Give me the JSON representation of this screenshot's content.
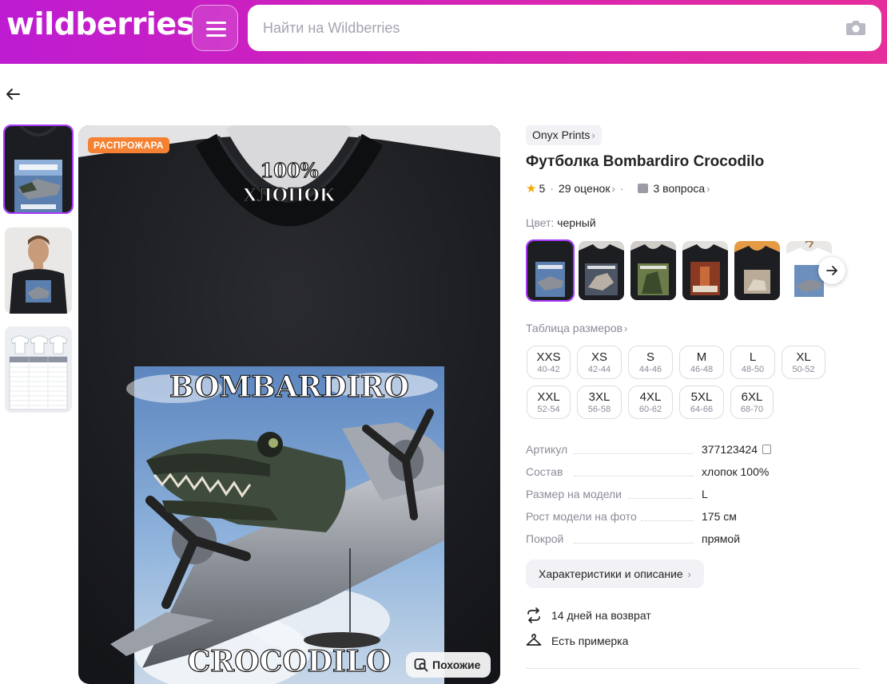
{
  "header": {
    "logo": "wildberries",
    "search_placeholder": "Найти на Wildberries"
  },
  "gallery": {
    "badge": "РАСПРОЖАРА",
    "similar_label": "Похожие",
    "print_top": "100%",
    "print_bottom": "ХЛОПОК",
    "graphic_title": "BOMBARDIRO",
    "graphic_caption": "CROCODILO"
  },
  "product": {
    "brand": "Onyx Prints",
    "title": "Футболка Bombardiro Crocodilo",
    "rating": "5",
    "reviews": "29 оценок",
    "questions": "3 вопроса",
    "color_label": "Цвет:",
    "color_value": "черный",
    "sizes_table_link": "Таблица размеров",
    "sizes": [
      {
        "size": "XXS",
        "range": "40-42"
      },
      {
        "size": "XS",
        "range": "42-44"
      },
      {
        "size": "S",
        "range": "44-46"
      },
      {
        "size": "M",
        "range": "46-48"
      },
      {
        "size": "L",
        "range": "48-50"
      },
      {
        "size": "XL",
        "range": "50-52"
      },
      {
        "size": "XXL",
        "range": "52-54"
      },
      {
        "size": "3XL",
        "range": "56-58"
      },
      {
        "size": "4XL",
        "range": "60-62"
      },
      {
        "size": "5XL",
        "range": "64-66"
      },
      {
        "size": "6XL",
        "range": "68-70"
      }
    ],
    "specs": [
      {
        "key": "Артикул",
        "value": "377123424"
      },
      {
        "key": "Состав",
        "value": "хлопок 100%"
      },
      {
        "key": "Размер на модели",
        "value": "L"
      },
      {
        "key": "Рост модели на фото",
        "value": "175 см"
      },
      {
        "key": "Покрой",
        "value": "прямой"
      }
    ],
    "details_button": "Характеристики и описание",
    "features": [
      {
        "icon": "return-arrows-icon",
        "label": "14 дней на возврат"
      },
      {
        "icon": "hanger-icon",
        "label": "Есть примерка"
      }
    ]
  },
  "colors": {
    "accent": "#a73afd",
    "brand_gradient_start": "#bd1cd1",
    "brand_gradient_end": "#e62d9c",
    "sale_badge": "#f58233",
    "star": "#f1a900"
  }
}
